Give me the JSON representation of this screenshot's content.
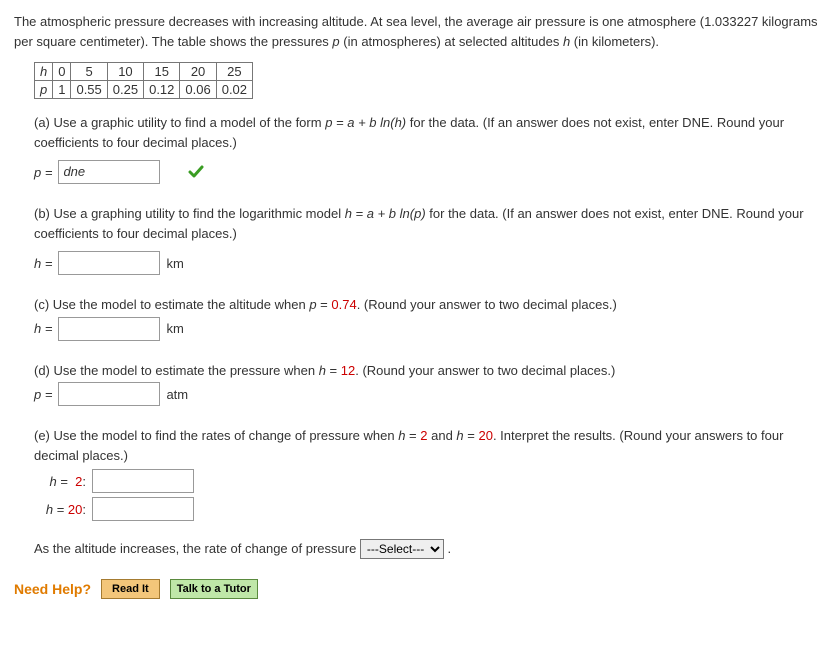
{
  "intro": {
    "line1a": "The atmospheric pressure decreases with increasing altitude. At sea level, the average air pressure is one atmosphere (1.033227 kilograms per square centimeter). The table shows the pressures ",
    "line1b": " (in atmospheres) at selected altitudes ",
    "line1c": " (in kilometers)."
  },
  "table": {
    "row1_label": "h",
    "row1": [
      "0",
      "5",
      "10",
      "15",
      "20",
      "25"
    ],
    "row2_label": "p",
    "row2": [
      "1",
      "0.55",
      "0.25",
      "0.12",
      "0.06",
      "0.02"
    ]
  },
  "partA": {
    "text1": "(a) Use a graphic utility to find a model of the form ",
    "formula_left": "p",
    "formula_right": " = a + b ln(h)",
    "text2": " for the data.  (If an answer does not exist, enter DNE. Round your coefficients to four decimal places.)",
    "var_label": "p = ",
    "input_value": "dne"
  },
  "partB": {
    "text1": "(b) Use a graphing utility to find the logarithmic model  ",
    "formula": "h = a + b ln(p)",
    "text2": "  for the data. (If an answer does not exist, enter DNE. Round your coefficients to four decimal places.)",
    "var_label": "h = ",
    "unit": "km"
  },
  "partC": {
    "text1": "(c) Use the model to estimate the altitude when ",
    "var": "p",
    "eq": " = ",
    "val": "0.74",
    "text2": ". (Round your answer to two decimal places.)",
    "var_label": "h = ",
    "unit": "km"
  },
  "partD": {
    "text1": "(d) Use the model to estimate the pressure when ",
    "var": "h",
    "eq": " = ",
    "val": "12",
    "text2": ". (Round your answer to two decimal places.)",
    "var_label": "p = ",
    "unit": "atm"
  },
  "partE": {
    "text1": "(e) Use the model to find the rates of change of pressure when ",
    "var1": "h",
    "eq": " = ",
    "val1": "2",
    "and": " and ",
    "var2": "h",
    "val2": "20",
    "text2": ". Interpret the results. (Round your answers to four decimal places.)",
    "row1_label": "h =  2:",
    "row2_label": "h = 20:",
    "sentence_before": "As the altitude increases, the rate of change of pressure ",
    "select_placeholder": "---Select---",
    "sentence_after": " ."
  },
  "help": {
    "label": "Need Help?",
    "read": "Read It",
    "tutor": "Talk to a Tutor"
  }
}
